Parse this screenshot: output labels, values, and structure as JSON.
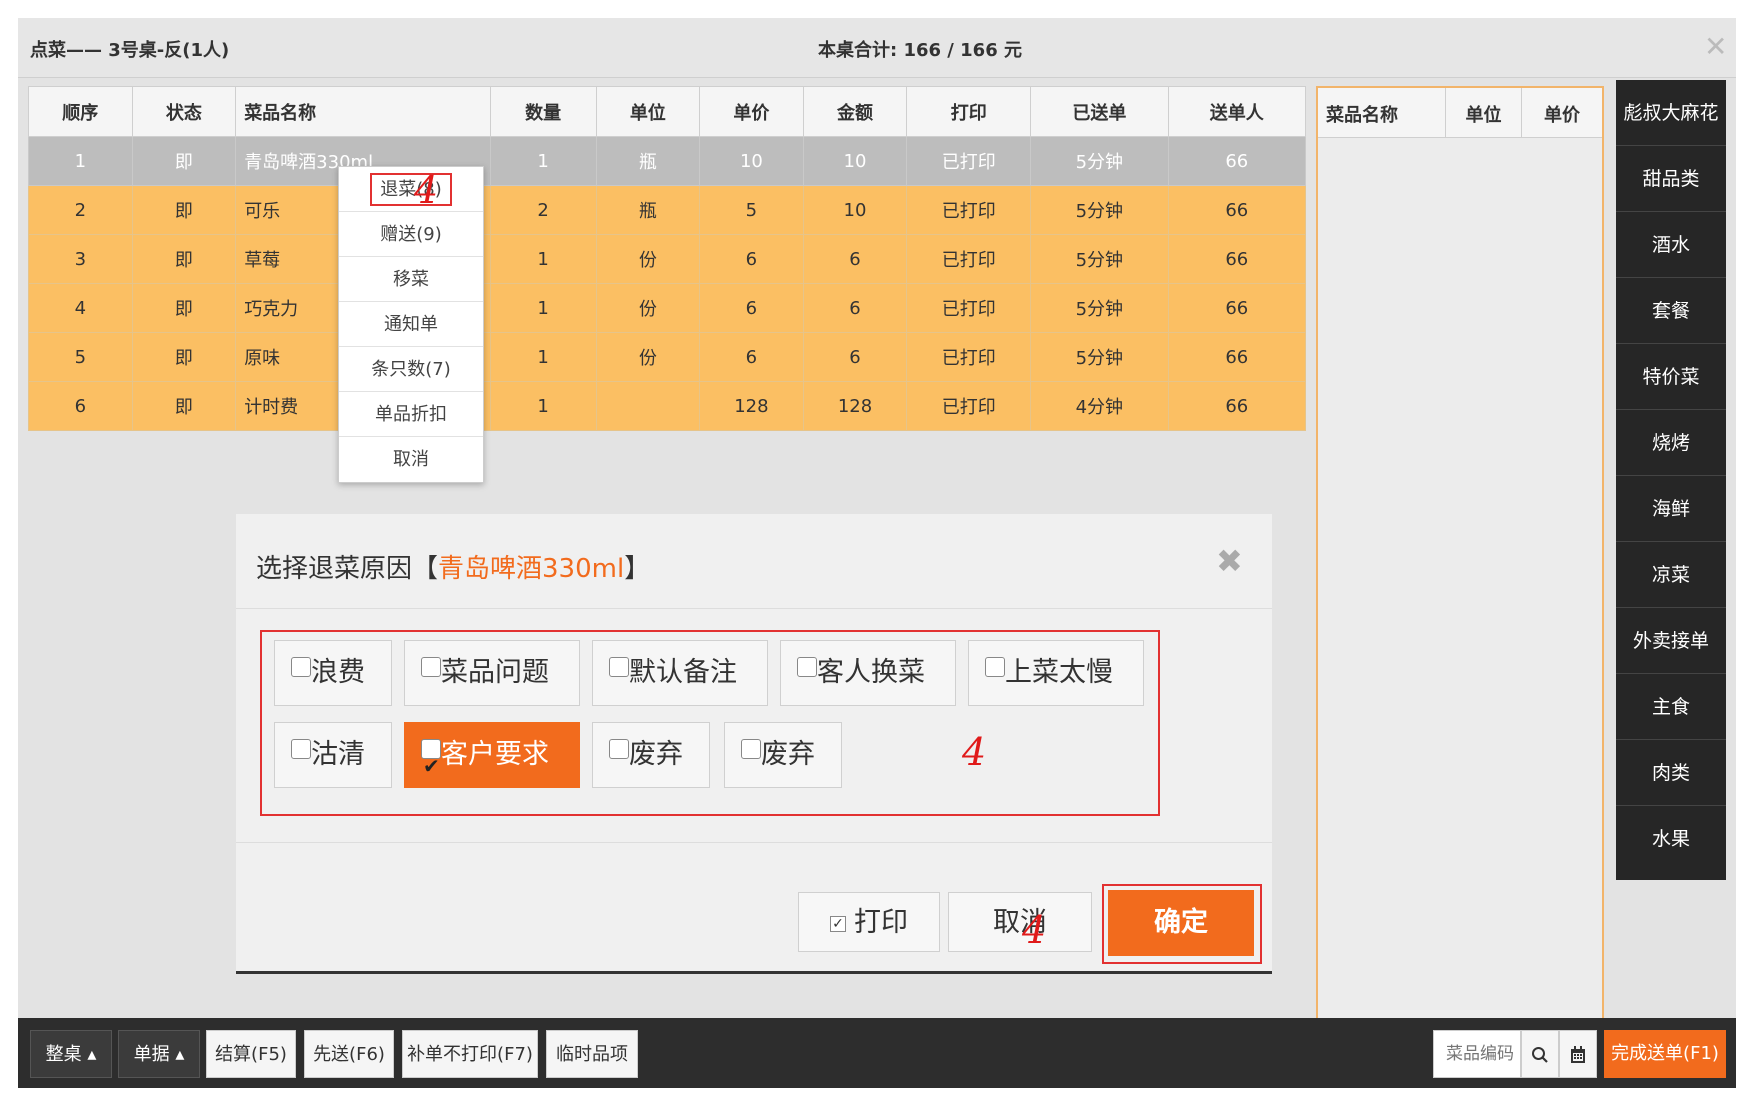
{
  "title_bar": {
    "left_title": "点菜—— 3号桌-反(1人)",
    "total_label": "本桌合计: 166 / 166 元",
    "close_icon": "close-icon"
  },
  "table": {
    "columns": [
      "顺序",
      "状态",
      "菜品名称",
      "数量",
      "单位",
      "单价",
      "金额",
      "打印",
      "已送单",
      "送单人"
    ],
    "rows": [
      {
        "seq": "1",
        "status": "即",
        "name": "青岛啤酒330ml",
        "qty": "1",
        "unit": "瓶",
        "price": "10",
        "amount": "10",
        "print": "已打印",
        "sent": "5分钟",
        "person": "66",
        "selected": true
      },
      {
        "seq": "2",
        "status": "即",
        "name": "可乐",
        "qty": "2",
        "unit": "瓶",
        "price": "5",
        "amount": "10",
        "print": "已打印",
        "sent": "5分钟",
        "person": "66"
      },
      {
        "seq": "3",
        "status": "即",
        "name": "草莓",
        "qty": "1",
        "unit": "份",
        "price": "6",
        "amount": "6",
        "print": "已打印",
        "sent": "5分钟",
        "person": "66"
      },
      {
        "seq": "4",
        "status": "即",
        "name": "巧克力",
        "qty": "1",
        "unit": "份",
        "price": "6",
        "amount": "6",
        "print": "已打印",
        "sent": "5分钟",
        "person": "66"
      },
      {
        "seq": "5",
        "status": "即",
        "name": "原味",
        "qty": "1",
        "unit": "份",
        "price": "6",
        "amount": "6",
        "print": "已打印",
        "sent": "5分钟",
        "person": "66"
      },
      {
        "seq": "6",
        "status": "即",
        "name": "计时费",
        "qty": "1",
        "unit": "",
        "price": "128",
        "amount": "128",
        "print": "已打印",
        "sent": "4分钟",
        "person": "66"
      }
    ]
  },
  "side_list": {
    "columns": [
      "菜品名称",
      "单位",
      "单价"
    ]
  },
  "categories": [
    "彪叔大麻花",
    "甜品类",
    "酒水",
    "套餐",
    "特价菜",
    "烧烤",
    "海鲜",
    "凉菜",
    "外卖接单",
    "主食",
    "肉类",
    "水果"
  ],
  "context_menu": {
    "items": [
      "退菜(8)",
      "赠送(9)",
      "移菜",
      "通知单",
      "条只数(7)",
      "单品折扣",
      "取消"
    ]
  },
  "annotations": {
    "step_mark": "4"
  },
  "dialog": {
    "title_prefix": "选择退菜原因【",
    "dish": "青岛啤酒330ml",
    "title_suffix": "】",
    "reasons": [
      {
        "label": "浪费",
        "checked": false
      },
      {
        "label": "菜品问题",
        "checked": false
      },
      {
        "label": "默认备注",
        "checked": false
      },
      {
        "label": "客人换菜",
        "checked": false
      },
      {
        "label": "上菜太慢",
        "checked": false
      },
      {
        "label": "沽清",
        "checked": false
      },
      {
        "label": "客户要求",
        "checked": true
      },
      {
        "label": "废弃",
        "checked": false
      },
      {
        "label": "废弃",
        "checked": false
      }
    ],
    "print_label": "打印",
    "cancel_label": "取消",
    "confirm_label": "确定"
  },
  "bottom_bar": {
    "whole_table": "整桌",
    "documents": "单据",
    "checkout": "结算(F5)",
    "send_first": "先送(F6)",
    "reorder_no_print": "补单不打印(F7)",
    "temp_item": "临时品项",
    "search_placeholder": "菜品编码",
    "finish": "完成送单(F1)"
  },
  "colors": {
    "accent": "#f26b1d",
    "row_highlight": "#fbbf63",
    "selected_row": "#bdbdbd",
    "annotation_red": "#e23131"
  }
}
